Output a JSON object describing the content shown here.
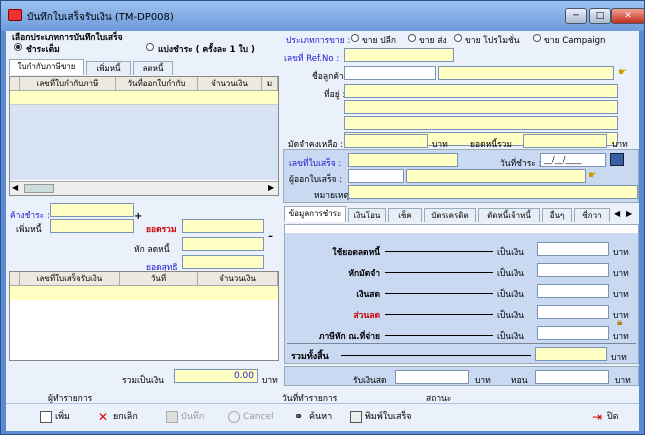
{
  "window": {
    "title": "บันทึกใบเสร็จรับเงิน (TM-DP008)",
    "min": "─",
    "max": "□",
    "close": "✕"
  },
  "record_type": {
    "label": "เลือกประเภทการบันทึกใบเสร็จ",
    "opt1": "ชำระเต็ม",
    "opt2": "แบ่งชำระ ( ครั้งละ 1 ใบ )"
  },
  "left_tabs": [
    "ใบกำกับภาษีขาย",
    "เพิ่มหนี้",
    "ลดหนี้"
  ],
  "invoice_grid": {
    "headers": [
      "เลขที่ใบกำกับภาษี",
      "วันที่ออกใบกำกับ",
      "จำนวนเงิน",
      "ม"
    ]
  },
  "sales_type": {
    "label": "ประเภทการขาย :",
    "opts": [
      "ขาย ปลีก",
      "ขาย ส่ง",
      "ขาย โปรโมชั่น",
      "ขาย Campaign"
    ]
  },
  "customer": {
    "ref_label": "เลขที่ Ref.No :",
    "name_label": "ชื่อลูกค้า :",
    "addr_label": "ที่อยู่ :",
    "deposit_label": "มัดจำคงเหลือ :",
    "baht": "บาท",
    "debt_label": "ยอดหนี้รวม"
  },
  "receipt": {
    "no_label": "เลขที่ใบเสร็จ :",
    "date_label": "วันที่ชำระ :",
    "date_value": "__/__/____",
    "issuer_label": "ผู้ออกใบเสร็จ :",
    "note_label": "หมายเหตุ :"
  },
  "pay": {
    "due_label": "ค้างชำระ :",
    "add_label": "เพิ่มหนี้",
    "total_label": "ยอดรวม",
    "discount_label": "หัก ลดหนี้",
    "net_label": "ยอดสุทธิ",
    "plus": "+",
    "minus": "–"
  },
  "receipt_grid": {
    "headers": [
      "เลขที่ใบเสร็จรับเงิน",
      "วันที่",
      "จำนวนเงิน"
    ]
  },
  "right_tabs": [
    "ข้อมูลการชำระ",
    "เงินโอน",
    "เช็ค",
    "บัตรเครดิต",
    "ตัดหนี้เจ้าหนี้",
    "อื่นๆ",
    "ซี่กวา"
  ],
  "payment_rows": [
    {
      "label": "ใช้ยอดลดหนี้",
      "as": "เป็นเงิน",
      "baht": "บาท"
    },
    {
      "label": "หักมัดจำ",
      "as": "เป็นเงิน",
      "baht": "บาท"
    },
    {
      "label": "เงินสด",
      "as": "เป็นเงิน",
      "baht": "บาท"
    },
    {
      "label": "ส่วนลด",
      "as": "เป็นเงิน",
      "baht": "บาท"
    },
    {
      "label": "ภาษีหัก ณ.ที่จ่าย",
      "as": "เป็นเงิน",
      "baht": "บาท"
    }
  ],
  "grand_total": {
    "label": "รวมทั้งสิ้น",
    "baht": "บาท"
  },
  "bottom": {
    "sum_label": "รวมเป็นเงิน",
    "sum_value": "0.00",
    "baht": "บาท",
    "cash_label": "รับเงินสด",
    "baht2": "บาท",
    "change_label": "ทอน",
    "baht3": "บาท"
  },
  "footer": {
    "creator_label": "ผู้ทำรายการ",
    "date_label": "วันที่ทำรายการ",
    "status_label": "สถานะ"
  },
  "toolbar": {
    "add": "เพิ่ม",
    "cancel_edit": "ยกเลิก",
    "save": "บันทึก",
    "cancel": "Cancel",
    "search": "ค้นหา",
    "print": "พิมพ์ใบเสร็จ",
    "close": "ปิด"
  }
}
